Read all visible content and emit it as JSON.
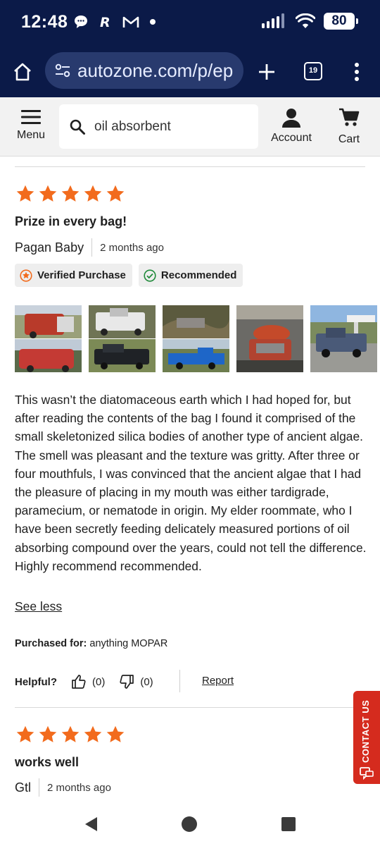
{
  "status_bar": {
    "time": "12:48",
    "notification_icons": [
      "chat-bubble-icon",
      "r-app-icon",
      "gmail-icon",
      "dot-icon"
    ],
    "signal_icons": [
      "signal-icon",
      "wifi-icon"
    ],
    "battery": "80"
  },
  "browser": {
    "url": "autozone.com/p/ep",
    "tab_count": "19",
    "icons": [
      "home-icon",
      "site-settings-icon",
      "new-tab-icon",
      "tabs-icon",
      "more-menu-icon"
    ]
  },
  "header": {
    "menu_label": "Menu",
    "search_value": "oil absorbent",
    "account_label": "Account",
    "cart_label": "Cart"
  },
  "reviews": [
    {
      "rating": 5,
      "title": "Prize in every bag!",
      "author": "Pagan Baby",
      "date": "2 months ago",
      "badges": {
        "verified": "Verified Purchase",
        "recommended": "Recommended"
      },
      "photo_count": 5,
      "body": "This wasn’t the diatomaceous earth which I had hoped for, but after reading the contents of the bag I found it comprised of the small skeletonized silica bodies of another type of ancient algae. The smell was pleasant and the texture was gritty. After three or four mouthfuls, I was convinced that the ancient algae that I had the pleasure of placing in my mouth was either tardigrade, paramecium, or nematode in origin. My elder roommate, who I have been secretly feeding delicately measured portions of oil absorbing compound over the years, could not tell the difference. Highly recommend recommended.",
      "see_less": "See less",
      "purchased_for_label": "Purchased for:",
      "purchased_for_value": "anything MOPAR",
      "helpful_label": "Helpful?",
      "helpful_up": "(0)",
      "helpful_down": "(0)",
      "report_label": "Report"
    },
    {
      "rating": 5,
      "title": "works well",
      "author": "Gtl",
      "date": "2 months ago"
    }
  ],
  "contact_tab": {
    "label": "CONTACT US"
  },
  "colors": {
    "status_bg": "#0b1a48",
    "url_pill": "#283a6e",
    "star": "#f26b1d",
    "verified_icon": "#f26b1d",
    "recommended_icon": "#1f8a3a",
    "contact_tab": "#d52b1e"
  },
  "nav_bar": {
    "icons": [
      "back-icon",
      "home-circle-icon",
      "recents-icon"
    ]
  }
}
